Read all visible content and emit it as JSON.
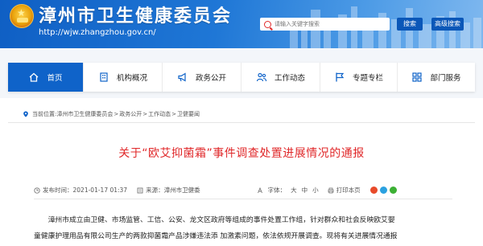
{
  "header": {
    "site_title": "漳州市卫生健康委员会",
    "site_url": "http://wjw.zhangzhou.gov.cn/",
    "search_placeholder": "请输入关键字搜索",
    "search_button": "搜索",
    "advanced_button": "高级搜索",
    "colors": {
      "header_blue": "#1f77d6",
      "button_blue": "#0b57b8"
    }
  },
  "nav": {
    "items": [
      {
        "label": "首页",
        "icon": "home-icon",
        "active": true
      },
      {
        "label": "机构概况",
        "icon": "building-icon"
      },
      {
        "label": "政务公开",
        "icon": "megaphone-icon"
      },
      {
        "label": "工作动态",
        "icon": "people-icon"
      },
      {
        "label": "专题专栏",
        "icon": "flag-icon"
      },
      {
        "label": "部门服务",
        "icon": "grid-icon"
      }
    ]
  },
  "breadcrumb": {
    "label": "当前位置:",
    "items": [
      "漳州市卫生健康委员会",
      "政务公开",
      "工作动态",
      "卫健要闻"
    ],
    "separator": ">"
  },
  "article": {
    "title": "关于“欧艾抑菌霜”事件调查处置进展情况的通报",
    "date_label": "发布时间：2021-01-17 01:37",
    "source_label": "来源：漳州市卫健委",
    "font_label": "字体：",
    "font_sizes": [
      "大",
      "中",
      "小"
    ],
    "print_label": "打印本页",
    "paragraph_lines": [
      "漳州市成立由卫健、市场监管、工信、公安、龙文区政府等组成的事件处置工作组，针对群众和社会反映欧艾婴",
      "童健康护理用品有限公司生产的两款抑菌霜产品涉嫌违法添 加激素问题，依法依规开展调查。现将有关进展情况通报"
    ],
    "title_color": "#e0282a"
  }
}
